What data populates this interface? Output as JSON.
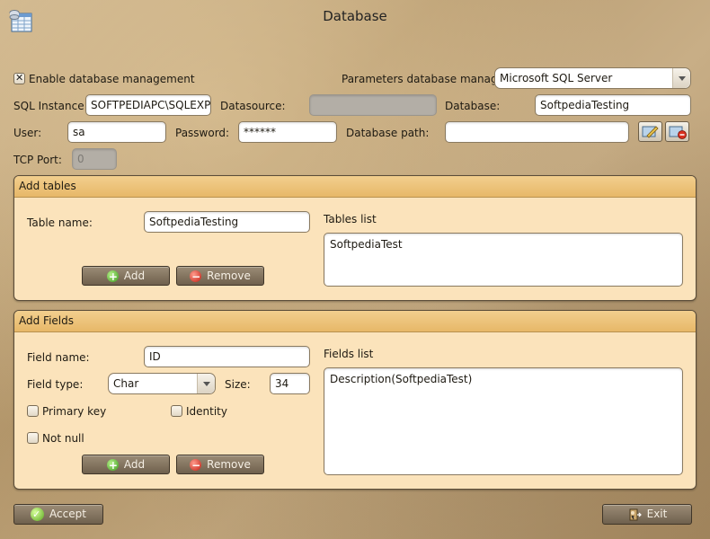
{
  "window": {
    "title": "Database"
  },
  "top": {
    "enable_label": "Enable database management",
    "enable_checked": true,
    "params_label": "Parameters database manager:",
    "params_value": "Microsoft SQL Server",
    "sql_instance_label": "SQL Instance:",
    "sql_instance_value": "SOFTPEDIAPC\\SQLEXPRESS",
    "datasource_label": "Datasource:",
    "datasource_value": "",
    "database_label": "Database:",
    "database_value": "SoftpediaTesting",
    "user_label": "User:",
    "user_value": "sa",
    "password_label": "Password:",
    "password_value": "******",
    "db_path_label": "Database path:",
    "db_path_value": "",
    "tcp_port_label": "TCP Port:",
    "tcp_port_value": "0"
  },
  "add_tables": {
    "header": "Add tables",
    "table_name_label": "Table name:",
    "table_name_value": "SoftpediaTesting",
    "tables_list_label": "Tables list",
    "tables_list": [
      "SoftpediaTest"
    ],
    "add_label": "Add",
    "remove_label": "Remove"
  },
  "add_fields": {
    "header": "Add Fields",
    "field_name_label": "Field name:",
    "field_name_value": "ID",
    "field_type_label": "Field type:",
    "field_type_value": "Char",
    "size_label": "Size:",
    "size_value": "34",
    "primary_key_label": "Primary key",
    "identity_label": "Identity",
    "not_null_label": "Not null",
    "fields_list_label": "Fields list",
    "fields_list": [
      "Description(SoftpediaTest)"
    ],
    "add_label": "Add",
    "remove_label": "Remove"
  },
  "footer": {
    "accept_label": "Accept",
    "exit_label": "Exit"
  }
}
